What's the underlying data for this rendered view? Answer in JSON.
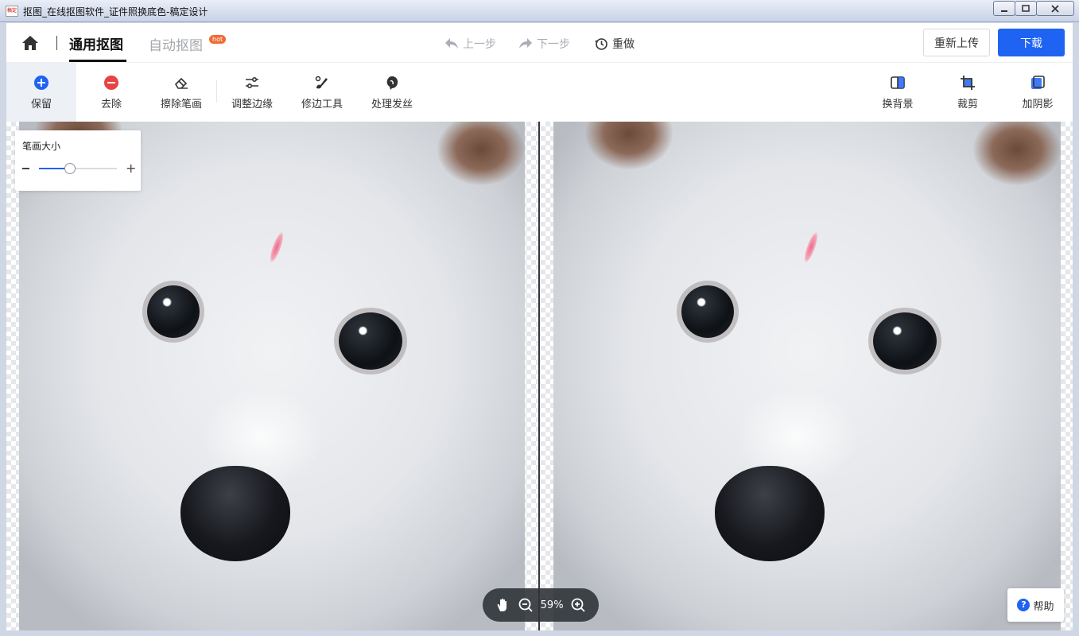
{
  "window": {
    "title": "抠图_在线抠图软件_证件照换底色-稿定设计",
    "icon_label": "稿定",
    "buttons": [
      "minimize",
      "maximize",
      "close"
    ]
  },
  "header": {
    "tabs": [
      {
        "label": "通用抠图",
        "active": true
      },
      {
        "label": "自动抠图",
        "active": false,
        "badge": "hot"
      }
    ],
    "undo_label": "上一步",
    "redo_label": "下一步",
    "reset_label": "重做",
    "reupload_label": "重新上传",
    "download_label": "下载"
  },
  "toolbar": {
    "left_tools": [
      {
        "label": "保留",
        "icon": "plus-circle-icon",
        "active": true
      },
      {
        "label": "去除",
        "icon": "minus-circle-icon",
        "active": false
      },
      {
        "label": "擦除笔画",
        "icon": "eraser-icon",
        "active": false
      },
      {
        "label": "调整边缘",
        "icon": "sliders-icon",
        "active": false
      },
      {
        "label": "修边工具",
        "icon": "brush-edit-icon",
        "active": false
      },
      {
        "label": "处理发丝",
        "icon": "hair-icon",
        "active": false
      }
    ],
    "right_tools": [
      {
        "label": "换背景",
        "icon": "background-icon"
      },
      {
        "label": "裁剪",
        "icon": "crop-icon"
      },
      {
        "label": "加阴影",
        "icon": "shadow-icon"
      }
    ]
  },
  "brush": {
    "title": "笔画大小",
    "minus": "−",
    "plus": "+",
    "level": 0.4
  },
  "zoom": {
    "value": "59%"
  },
  "help": {
    "q": "?",
    "label": "帮助"
  },
  "colors": {
    "accent": "#1f63f3",
    "remove": "#e84343",
    "hot_badge": "#f06b34"
  }
}
